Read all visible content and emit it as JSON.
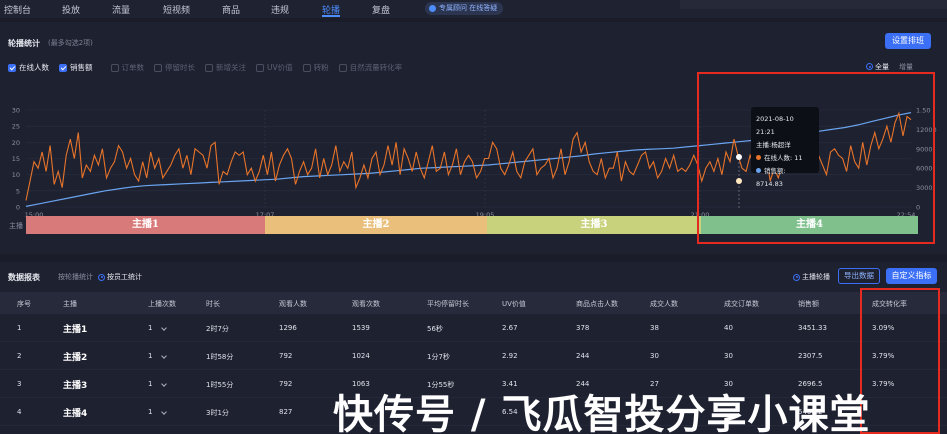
{
  "nav": {
    "tabs": [
      "控制台",
      "投放",
      "流量",
      "短视频",
      "商品",
      "违规",
      "轮播",
      "复盘"
    ],
    "active_index": 6,
    "pill": "专属顾问 在线答疑"
  },
  "chart_panel": {
    "title": "轮播统计",
    "subtitle": "(最多勾选2项)",
    "settings_button": "设置排班",
    "metrics": [
      {
        "label": "在线人数",
        "checked": true
      },
      {
        "label": "销售额",
        "checked": true
      },
      {
        "label": "订单数",
        "checked": false
      },
      {
        "label": "停留时长",
        "checked": false
      },
      {
        "label": "新增关注",
        "checked": false
      },
      {
        "label": "UV价值",
        "checked": false
      },
      {
        "label": "转粉",
        "checked": false
      },
      {
        "label": "自然流量转化率",
        "checked": false
      }
    ],
    "view_modes": [
      {
        "label": "全量",
        "selected": true
      },
      {
        "label": "增量",
        "selected": false
      }
    ],
    "host_row_label": "主播",
    "segments": [
      {
        "label": "主播1",
        "color": "#d97a7a"
      },
      {
        "label": "主播2",
        "color": "#e9bf7b"
      },
      {
        "label": "主播3",
        "color": "#c8d27c"
      },
      {
        "label": "主播4",
        "color": "#7fc08d"
      }
    ],
    "tooltip": {
      "time": "2021-08-10 21:21",
      "host": "主播:杨超洋",
      "series1_label": "在线人数:",
      "series1_value": "11",
      "series2_label": "销售额:",
      "series2_value": "8714.83",
      "series1_color": "#e8742a",
      "series2_color": "#6aa4f0"
    }
  },
  "chart_data": {
    "type": "line",
    "x_ticks": [
      "15:00",
      "17:07",
      "19:05",
      "21:00",
      "22:54"
    ],
    "y_left_ticks": [
      "0",
      "5",
      "10",
      "15",
      "20",
      "25",
      "30"
    ],
    "y_left_range": [
      0,
      30
    ],
    "y_right_ticks": [
      "0",
      "3000",
      "6000",
      "9000",
      "12000",
      "15000"
    ],
    "y_right_range": [
      0,
      15000
    ],
    "y_right_top_label": "1.50",
    "series": [
      {
        "axis": "left",
        "color": "#e8742a",
        "values": [
          2,
          8,
          14,
          12,
          17,
          11,
          19,
          7,
          11,
          6,
          16,
          21,
          15,
          23,
          9,
          13,
          11,
          16,
          13,
          18,
          9,
          12,
          14,
          19,
          17,
          12,
          15,
          10,
          8,
          14,
          9,
          17,
          12,
          15,
          9,
          11,
          13,
          16,
          18,
          12,
          16,
          10,
          18,
          17,
          16,
          12,
          19,
          20,
          7,
          11,
          10,
          14,
          17,
          16,
          17,
          10,
          12,
          8,
          11,
          16,
          10,
          17,
          8,
          13,
          16,
          18,
          15,
          7,
          11,
          14,
          10,
          12,
          18,
          9,
          15,
          10,
          13,
          19,
          11,
          14,
          12,
          17,
          6,
          9,
          13,
          9,
          15,
          17,
          10,
          13,
          19,
          13,
          20,
          10,
          18,
          15,
          11,
          17,
          12,
          9,
          14,
          19,
          11,
          12,
          17,
          10,
          13,
          18,
          10,
          14,
          16,
          14,
          9,
          11,
          15,
          15,
          20,
          18,
          12,
          10,
          13,
          17,
          11,
          9,
          14,
          16,
          18,
          10,
          12,
          13,
          15,
          9,
          12,
          18,
          10,
          14,
          21,
          23,
          17,
          20,
          14,
          11,
          10,
          15,
          9,
          12,
          12,
          17,
          8,
          14,
          11,
          10,
          13,
          16,
          17,
          12,
          14,
          9,
          11,
          15,
          12,
          16,
          11,
          12,
          11,
          13,
          16,
          13,
          8,
          12,
          14,
          11,
          15,
          10,
          17,
          14,
          21,
          16,
          12,
          11,
          16,
          13,
          12,
          15,
          16,
          8,
          12,
          9,
          13,
          11,
          18,
          14,
          15,
          12,
          16,
          11,
          14,
          16,
          13,
          10,
          17,
          18,
          16,
          15,
          11,
          19,
          14,
          12,
          20,
          13,
          19,
          23,
          18,
          21,
          25,
          20,
          26,
          29,
          22,
          28,
          27
        ]
      },
      {
        "axis": "right",
        "color": "#6aa4f0",
        "values": [
          100,
          500,
          900,
          1300,
          1700,
          2100,
          2500,
          2800,
          3100,
          3300,
          3400,
          3500,
          3600,
          3700,
          3800,
          3900,
          4000,
          4100,
          4200,
          4300,
          4500,
          4700,
          4800,
          4900,
          5000,
          5100,
          5200,
          5400,
          5600,
          5800,
          6000,
          6100,
          6200,
          6300,
          6400,
          6500,
          6700,
          6900,
          7100,
          7300,
          7500,
          7700,
          7900,
          8200,
          8400,
          8600,
          8800,
          8900,
          9000,
          9100,
          9300,
          9500,
          9700,
          9900,
          10100,
          10300,
          10500,
          10800,
          11100,
          11400,
          11700,
          12000,
          12300,
          12700,
          13200,
          13700,
          14200,
          14600
        ]
      }
    ]
  },
  "table_panel": {
    "title": "数据报表",
    "options": [
      {
        "label": "按轮播统计",
        "selected": false
      },
      {
        "label": "按员工统计",
        "selected": true
      }
    ],
    "host_option": "主播轮播",
    "export_button": "导出数据",
    "custom_button": "自定义指标",
    "columns": [
      "序号",
      "主播",
      "上播次数",
      "时长",
      "观看人数",
      "观看次数",
      "平均停留时长",
      "UV价值",
      "商品点击人数",
      "成交人数",
      "成交订单数",
      "销售额",
      "成交转化率"
    ],
    "rows": [
      [
        "1",
        "主播1",
        "1",
        "2时7分",
        "1296",
        "1539",
        "56秒",
        "2.67",
        "378",
        "38",
        "40",
        "3451.33",
        "3.09%"
      ],
      [
        "2",
        "主播2",
        "1",
        "1时58分",
        "792",
        "1024",
        "1分7秒",
        "2.92",
        "244",
        "30",
        "30",
        "2307.5",
        "3.79%"
      ],
      [
        "3",
        "主播3",
        "1",
        "1时55分",
        "792",
        "1063",
        "1分55秒",
        "3.41",
        "244",
        "27",
        "30",
        "2696.5",
        "3.79%"
      ],
      [
        "4",
        "主播4",
        "1",
        "3时1分",
        "827",
        "",
        "",
        "6.54",
        "",
        "57",
        "",
        "5401.2",
        ""
      ]
    ]
  },
  "watermark": "快传号 / 飞瓜智投分享小课堂",
  "colors": {
    "accent": "#3b6ff5",
    "highlight_box": "#e52a20"
  }
}
